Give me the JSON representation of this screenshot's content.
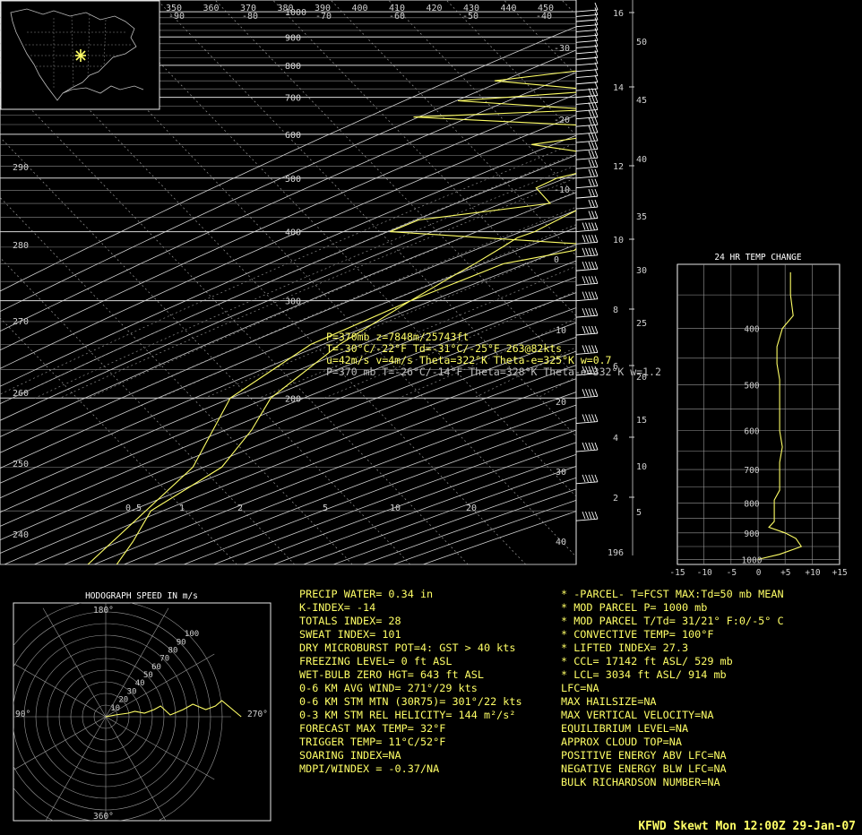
{
  "colors": {
    "background": "#000000",
    "grid": "#e6e6e6",
    "dashed": "#9a9a9a",
    "trace": "#ffff66",
    "text": "#ffff66",
    "white": "#ffffff"
  },
  "skewt": {
    "temp_top_labels": [
      "-90",
      "-80",
      "-70",
      "-60",
      "-50",
      "-40"
    ],
    "theta_top_labels": [
      "350",
      "360",
      "370",
      "380",
      "390",
      "400",
      "410",
      "420",
      "430",
      "440",
      "450"
    ],
    "pressure_labels": [
      "200",
      "300",
      "400",
      "500",
      "600",
      "700",
      "800",
      "900",
      "1000"
    ],
    "theta_left_labels": [
      "290",
      "280",
      "270",
      "260",
      "250",
      "240"
    ],
    "isotherm_side_labels": [
      "-30",
      "-20",
      "-10",
      "0",
      "10",
      "20",
      "30",
      "40"
    ],
    "mixing_labels": [
      "0.5",
      "1",
      "2",
      "5",
      "10",
      "20"
    ],
    "km_labels": [
      "16",
      "14",
      "12",
      "10",
      "8",
      "6",
      "4",
      "2"
    ],
    "kft_labels": [
      "50",
      "45",
      "40",
      "35",
      "30",
      "25",
      "20",
      "15",
      "10",
      "5"
    ],
    "extra_label": "196"
  },
  "readout": {
    "line1": "P=370mb z=7848m/25743ft",
    "line2": "T=-30°C/-22°F Td=-31°C/-25°F 263@82kts",
    "line3": "u=42m/s v=4m/s Theta=322°K Theta-e=325°K w=0.7",
    "line4": "P=370 mb T=-26°C/-14°F Theta=328°K Theta-e=332°K w=1.2"
  },
  "temp_change": {
    "title": "24 HR TEMP CHANGE",
    "pressure_labels": [
      "400",
      "500",
      "600",
      "700",
      "800",
      "900",
      "1000"
    ],
    "x_labels": [
      "-15",
      "-10",
      "-5",
      "0",
      "+5",
      "+10",
      "+15"
    ]
  },
  "hodograph": {
    "title": "HODOGRAPH SPEED IN m/s",
    "ring_labels": [
      "10",
      "20",
      "30",
      "40",
      "50",
      "60",
      "70",
      "80",
      "90",
      "100"
    ],
    "direction_labels": [
      "180°",
      "270°",
      "360°",
      "90°"
    ]
  },
  "indices_left": [
    "PRECIP  WATER=  0.34  in",
    "K-INDEX=  -14",
    "TOTALS  INDEX=  28",
    "SWEAT  INDEX=  101",
    "DRY  MICROBURST  POT=4:  GST  >  40  kts",
    "FREEZING  LEVEL=  0  ft  ASL",
    "WET-BULB  ZERO  HGT=  643  ft  ASL",
    "0-6  KM  AVG  WIND=  271°/29  kts",
    "0-6  KM  STM  MTN  (30R75)=  301°/22  kts",
    "0-3  KM  STM  REL  HELICITY=  144  m²/s²",
    "FORECAST  MAX  TEMP=  32°F",
    "TRIGGER  TEMP=  11°C/52°F",
    "SOARING  INDEX=NA",
    "MDPI/WINDEX  =  -0.37/NA"
  ],
  "indices_right": [
    "*  -PARCEL-  T=FCST  MAX:Td=50  mb  MEAN",
    "*  MOD  PARCEL  P=  1000  mb",
    "*  MOD  PARCEL  T/Td=  31/21° F:0/-5° C",
    "*  CONVECTIVE  TEMP=  100°F",
    "*  LIFTED  INDEX=  27.3",
    "*  CCL=  17142  ft  ASL/  529  mb",
    "*  LCL=  3034  ft  ASL/  914  mb",
    "LFC=NA",
    "MAX  HAILSIZE=NA",
    "MAX  VERTICAL  VELOCITY=NA",
    "EQUILIBRIUM  LEVEL=NA",
    "APPROX  CLOUD  TOP=NA",
    "POSITIVE  ENERGY  ABV  LFC=NA",
    "NEGATIVE  ENERGY  BLW  LFC=NA",
    "BULK  RICHARDSON  NUMBER=NA"
  ],
  "footer": "KFWD Skewt  Mon 12:00Z 29-Jan-07",
  "chart_data": [
    {
      "type": "line",
      "title": "",
      "y_scale": "log-pressure",
      "ylim_mb": [
        1050,
        100
      ],
      "series": [
        {
          "values_p_mb": [
            1000,
            985,
            975,
            950,
            925,
            900,
            880,
            850,
            800,
            750,
            700,
            650,
            600,
            550,
            500,
            470,
            450,
            430,
            400,
            390,
            375,
            350,
            330,
            300,
            250,
            200,
            175,
            150,
            125,
            110,
            100
          ],
          "values_t_c": [
            2,
            2,
            1.5,
            0.5,
            -1,
            -2,
            -2.5,
            -4,
            -6,
            -9,
            -12,
            -16,
            -20,
            -25,
            -30,
            -33,
            -35,
            -37,
            -40,
            -42,
            -43,
            -45,
            -47,
            -50,
            -55,
            -58,
            -56,
            -55,
            -60,
            -58,
            -57
          ]
        },
        {
          "values_p_mb": [
            1000,
            985,
            960,
            930,
            905,
            880,
            855,
            830,
            810,
            780,
            750,
            720,
            690,
            665,
            645,
            620,
            600,
            575,
            545,
            520,
            500,
            480,
            450,
            420,
            400,
            380,
            370,
            350,
            300,
            250,
            200,
            150,
            100
          ],
          "values_td_c": [
            -1,
            -3,
            -8,
            -11,
            -12,
            -14,
            -30,
            -55,
            -42,
            -60,
            -72,
            -52,
            -75,
            -50,
            -80,
            -45,
            -44,
            -55,
            -38,
            -40,
            -45,
            -47,
            -42,
            -62,
            -65,
            -30,
            -30,
            -40,
            -50,
            -60,
            -65,
            -60,
            -62
          ]
        }
      ]
    },
    {
      "type": "line",
      "title": "",
      "xlim": [
        -15,
        15
      ],
      "ylim_mb": [
        1020,
        310
      ],
      "series": [
        {
          "values_p_mb": [
            320,
            350,
            380,
            400,
            430,
            460,
            490,
            520,
            560,
            600,
            640,
            680,
            720,
            760,
            790,
            820,
            860,
            880,
            900,
            920,
            950,
            980,
            1000
          ],
          "values_dt": [
            6,
            6,
            6.5,
            4.5,
            3.5,
            3.5,
            4,
            4,
            4,
            4,
            4.5,
            4,
            4,
            4,
            3,
            3,
            3,
            2,
            5,
            7,
            8,
            4,
            0
          ]
        }
      ]
    },
    {
      "type": "line",
      "title": "",
      "series": [
        {
          "values_u": [
            0,
            3,
            7,
            9,
            12,
            15,
            17,
            20,
            24,
            27,
            31,
            34,
            36,
            40,
            42
          ],
          "values_v": [
            0,
            1,
            2,
            3,
            2,
            4,
            6,
            1,
            4,
            7,
            4,
            6,
            9,
            3,
            0
          ]
        }
      ]
    }
  ]
}
